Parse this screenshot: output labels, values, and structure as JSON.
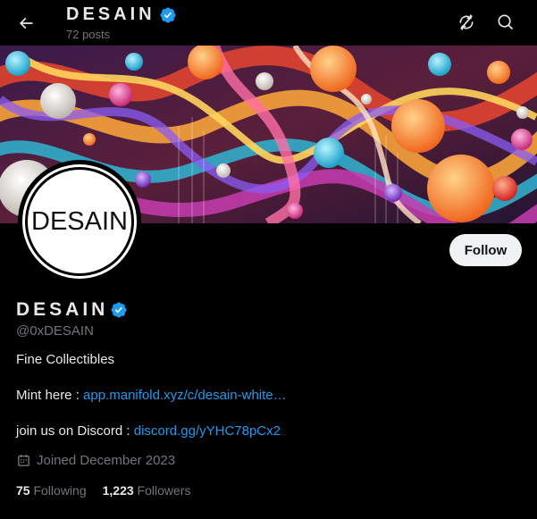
{
  "header": {
    "title": "DESAIN",
    "posts": "72 posts"
  },
  "avatar": {
    "text": "DESAIN"
  },
  "profile": {
    "name": "DESAIN",
    "handle": "@0xDESAIN",
    "bio_line1": "Fine Collectibles",
    "mint_label": "Mint here : ",
    "mint_link": "app.manifold.xyz/c/desain-white…",
    "discord_label": "join us on Discord : ",
    "discord_link": "discord.gg/yYHC78pCx2",
    "joined": "Joined December 2023",
    "following_count": "75",
    "following_label": "Following",
    "followers_count": "1,223",
    "followers_label": "Followers"
  },
  "buttons": {
    "follow": "Follow"
  },
  "icons": {
    "back": "back-arrow-icon",
    "refresh": "refresh-icon",
    "search": "search-icon",
    "verified": "verified-badge-icon",
    "calendar": "calendar-icon"
  },
  "colors": {
    "background": "#000000",
    "text": "#e7e9ea",
    "muted": "#71767b",
    "link": "#1d9bf0",
    "verified": "#1d9bf0",
    "follow_bg": "#eff3f4"
  }
}
